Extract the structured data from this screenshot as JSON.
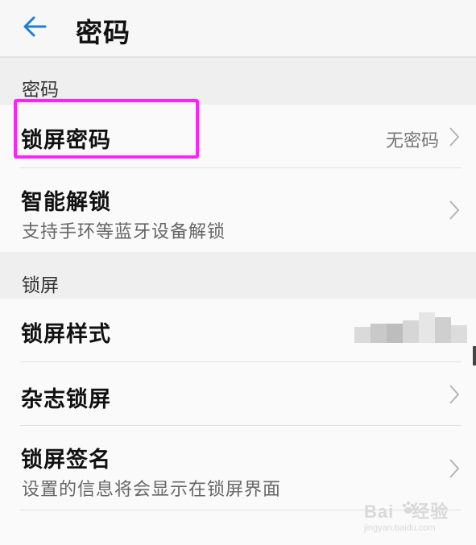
{
  "header": {
    "title": "密码"
  },
  "sections": [
    {
      "label": "密码",
      "rows": [
        {
          "title": "锁屏密码",
          "value": "无密码"
        },
        {
          "title": "智能解锁",
          "subtitle": "支持手环等蓝牙设备解锁"
        }
      ]
    },
    {
      "label": "锁屏",
      "rows": [
        {
          "title": "锁屏样式"
        },
        {
          "title": "杂志锁屏"
        },
        {
          "title": "锁屏签名",
          "subtitle": "设置的信息将会显示在锁屏界面"
        }
      ]
    }
  ],
  "watermark": {
    "brand_left": "Bai",
    "brand_right": "经验",
    "url": "jingyan.baidu.com"
  },
  "colors": {
    "accent": "#1a7fe0",
    "highlight": "#ff22ff"
  },
  "icons": {
    "back": "arrow-left-icon",
    "chevron": "chevron-right-icon"
  }
}
